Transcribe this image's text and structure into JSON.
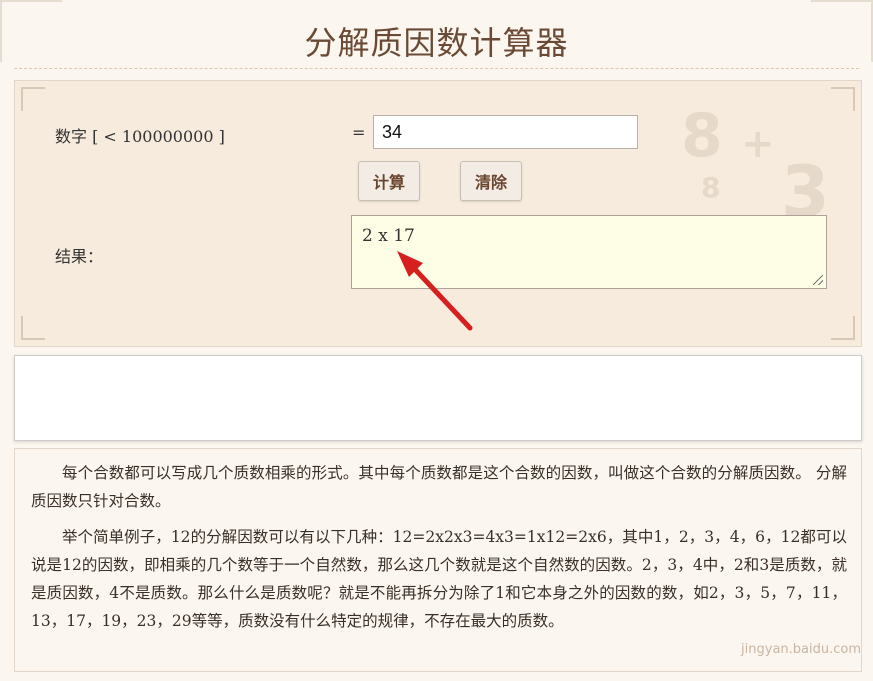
{
  "page": {
    "title": "分解质因数计算器"
  },
  "calculator": {
    "number_label": "数字 [ < 100000000 ]",
    "equals": "=",
    "input_value": "34",
    "calc_button": "计算",
    "clear_button": "清除",
    "result_label": "结果：",
    "result_value": "2 x 17"
  },
  "description": {
    "paragraphs": [
      "每个合数都可以写成几个质数相乘的形式。其中每个质数都是这个合数的因数，叫做这个合数的分解质因数。 分解质因数只针对合数。",
      "举个简单例子，12的分解因数可以有以下几种：12=2x2x3=4x3=1x12=2x6，其中1，2，3，4，6，12都可以说是12的因数，即相乘的几个数等于一个自然数，那么这几个数就是这个自然数的因数。2，3，4中，2和3是质数，就是质因数，4不是质数。那么什么是质数呢？就是不能再拆分为除了1和它本身之外的因数的数，如2，3，5，7，11，13，17，19，23，29等等，质数没有什么特定的规律，不存在最大的质数。"
    ]
  },
  "watermark": "jingyan.baidu.com",
  "colors": {
    "accent_brown": "#6a4630",
    "arrow_red": "#d6201f",
    "result_bg": "#fefde6"
  }
}
